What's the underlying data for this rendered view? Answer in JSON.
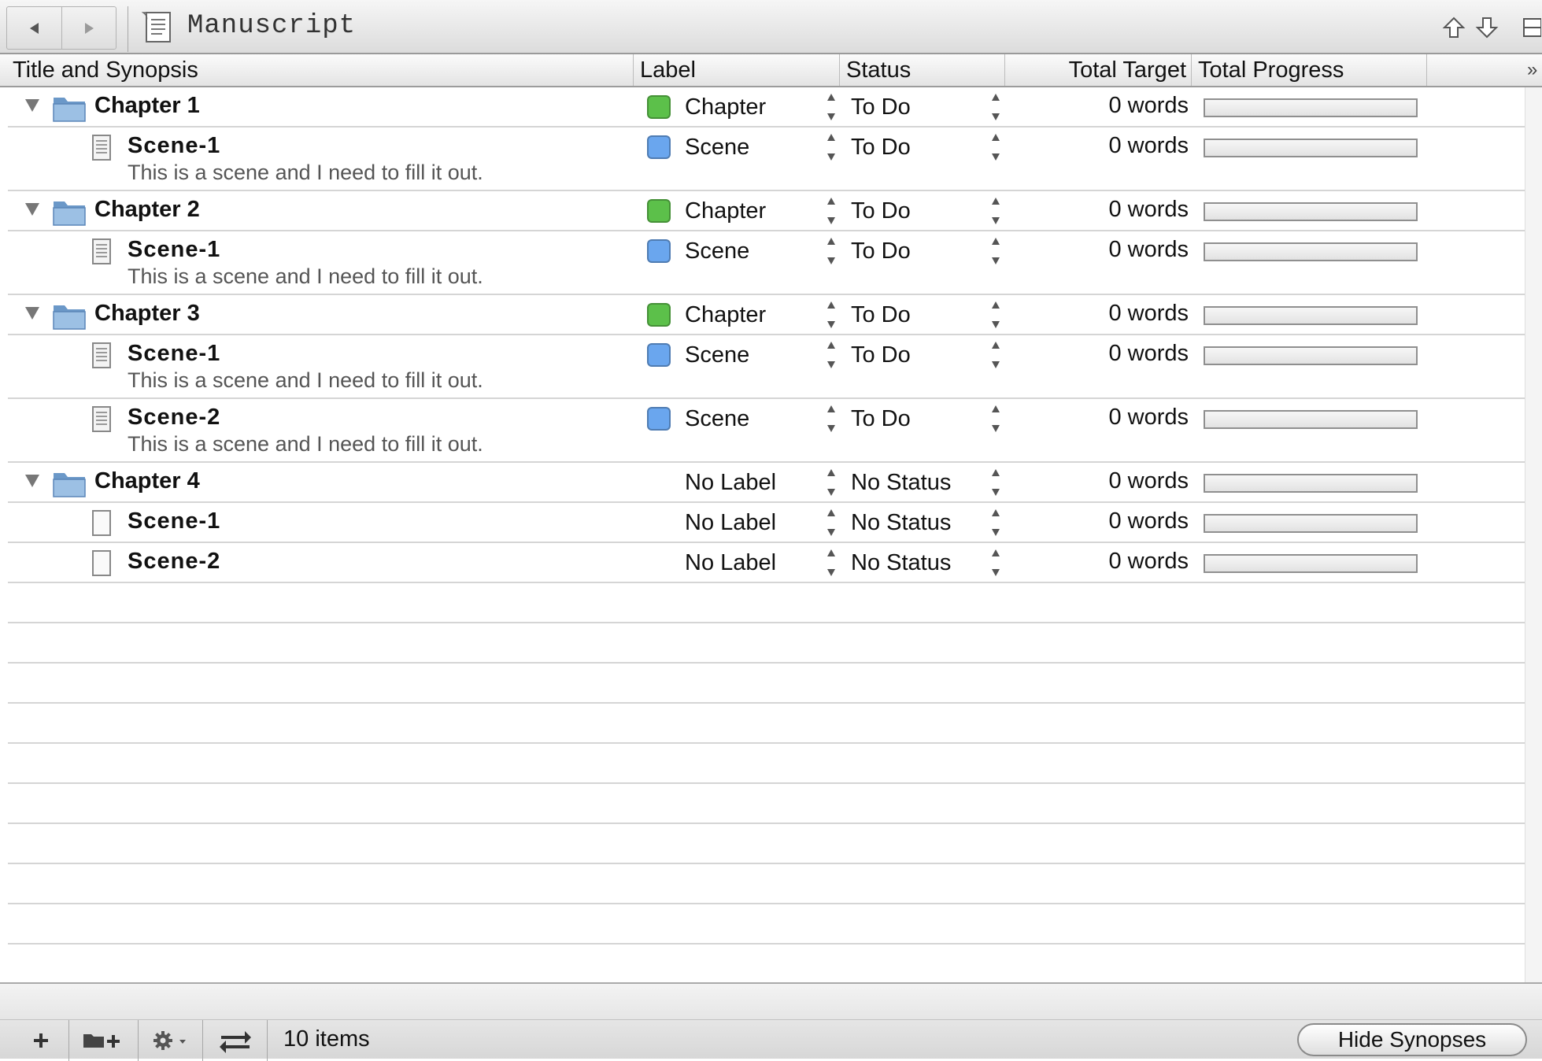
{
  "navbar": {
    "title": "Manuscript",
    "back_icon": "back-arrow-icon",
    "forward_icon": "forward-arrow-icon"
  },
  "columns": {
    "title": "Title and Synopsis",
    "label": "Label",
    "status": "Status",
    "target": "Total Target",
    "progress": "Total Progress",
    "more": "»"
  },
  "colors": {
    "chapter_label": "#5cc04a",
    "scene_label": "#6aa6ee"
  },
  "rows": [
    {
      "type": "chapter",
      "title": "Chapter 1",
      "synopsis": "",
      "label": "Chapter",
      "label_color": "#5cc04a",
      "status": "To Do",
      "target": "0 words",
      "progress": 0
    },
    {
      "type": "scene",
      "title": "Scene-1",
      "synopsis": "This is a scene and I need to fill it out.",
      "label": "Scene",
      "label_color": "#6aa6ee",
      "status": "To Do",
      "target": "0 words",
      "progress": 0
    },
    {
      "type": "chapter",
      "title": "Chapter 2",
      "synopsis": "",
      "label": "Chapter",
      "label_color": "#5cc04a",
      "status": "To Do",
      "target": "0 words",
      "progress": 0
    },
    {
      "type": "scene",
      "title": "Scene-1",
      "synopsis": "This is a scene and I need to fill it out.",
      "label": "Scene",
      "label_color": "#6aa6ee",
      "status": "To Do",
      "target": "0 words",
      "progress": 0
    },
    {
      "type": "chapter",
      "title": "Chapter 3",
      "synopsis": "",
      "label": "Chapter",
      "label_color": "#5cc04a",
      "status": "To Do",
      "target": "0 words",
      "progress": 0
    },
    {
      "type": "scene",
      "title": "Scene-1",
      "synopsis": "This is a scene and I need to fill it out.",
      "label": "Scene",
      "label_color": "#6aa6ee",
      "status": "To Do",
      "target": "0 words",
      "progress": 0
    },
    {
      "type": "scene",
      "title": "Scene-2",
      "synopsis": "This is a scene and I need to fill it out.",
      "label": "Scene",
      "label_color": "#6aa6ee",
      "status": "To Do",
      "target": "0 words",
      "progress": 0
    },
    {
      "type": "chapter",
      "title": "Chapter 4",
      "synopsis": "",
      "label": "No Label",
      "label_color": "",
      "status": "No Status",
      "target": "0 words",
      "progress": 0
    },
    {
      "type": "scene-empty",
      "title": "Scene-1",
      "synopsis": "",
      "label": "No Label",
      "label_color": "",
      "status": "No Status",
      "target": "0 words",
      "progress": 0
    },
    {
      "type": "scene-empty",
      "title": "Scene-2",
      "synopsis": "",
      "label": "No Label",
      "label_color": "",
      "status": "No Status",
      "target": "0 words",
      "progress": 0
    }
  ],
  "footer": {
    "item_count": "10 items",
    "hide_synopses": "Hide Synopses",
    "add_icon": "plus-icon",
    "add_folder_icon": "add-folder-icon",
    "gear_icon": "gear-icon",
    "swap_icon": "swap-arrows-icon"
  }
}
